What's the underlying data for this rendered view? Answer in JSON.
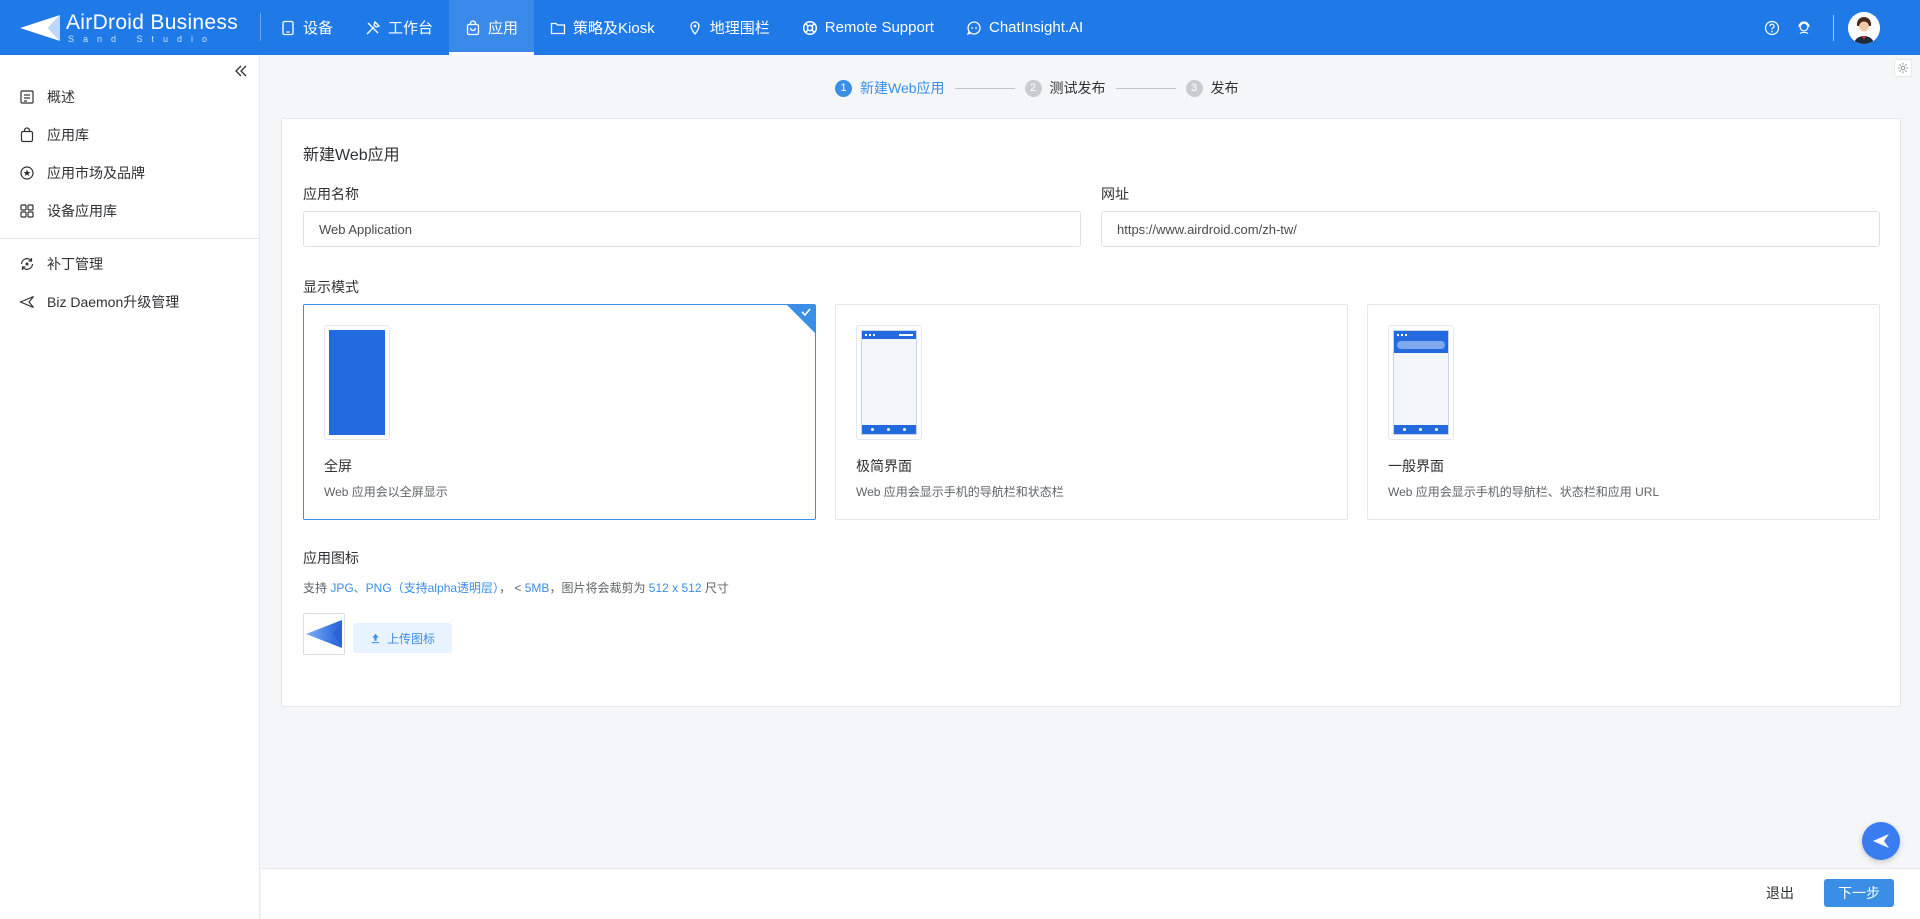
{
  "brand": {
    "title": "AirDroid Business",
    "subtitle": "Sand Studio"
  },
  "nav": {
    "items": [
      {
        "label": "设备",
        "icon": "tablet-icon",
        "active": false
      },
      {
        "label": "工作台",
        "icon": "tools-icon",
        "active": false
      },
      {
        "label": "应用",
        "icon": "app-bag-icon",
        "active": true
      },
      {
        "label": "策略及Kiosk",
        "icon": "folder-icon",
        "active": false
      },
      {
        "label": "地理围栏",
        "icon": "map-pin-icon",
        "active": false
      },
      {
        "label": "Remote Support",
        "icon": "lifebuoy-icon",
        "active": false
      },
      {
        "label": "ChatInsight.AI",
        "icon": "chat-bot-icon",
        "active": false
      }
    ],
    "right_icons": [
      "help-icon",
      "support-agent-icon",
      "user-avatar"
    ]
  },
  "sidebar": {
    "collapse_icon": "double-chevron-left-icon",
    "items": [
      {
        "label": "概述",
        "icon": "overview-icon"
      },
      {
        "label": "应用库",
        "icon": "app-library-icon"
      },
      {
        "label": "应用市场及品牌",
        "icon": "store-brand-icon"
      },
      {
        "label": "设备应用库",
        "icon": "device-apps-icon"
      }
    ],
    "items2": [
      {
        "label": "补丁管理",
        "icon": "patch-icon"
      },
      {
        "label": "Biz Daemon升级管理",
        "icon": "daemon-icon"
      }
    ]
  },
  "steps": [
    {
      "num": "1",
      "label": "新建Web应用",
      "active": true
    },
    {
      "num": "2",
      "label": "测试发布",
      "active": false
    },
    {
      "num": "3",
      "label": "发布",
      "active": false
    }
  ],
  "form": {
    "title": "新建Web应用",
    "name_label": "应用名称",
    "name_value": "Web Application",
    "url_label": "网址",
    "url_value": "https://www.airdroid.com/zh-tw/",
    "mode_label": "显示模式",
    "modes": [
      {
        "title": "全屏",
        "desc": "Web 应用会以全屏显示",
        "selected": true
      },
      {
        "title": "极简界面",
        "desc": "Web 应用会显示手机的导航栏和状态栏",
        "selected": false
      },
      {
        "title": "一般界面",
        "desc": "Web 应用会显示手机的导航栏、状态栏和应用 URL",
        "selected": false
      }
    ],
    "icon_label": "应用图标",
    "icon_hint": {
      "p1": "支持 ",
      "formats": "JPG、PNG（支持alpha透明层）",
      "p2": "， < ",
      "size": "5MB",
      "p3": "，图片将会裁剪为 ",
      "dims": "512 x 512",
      "p4": " 尺寸"
    },
    "upload_label": "上传图标"
  },
  "footer": {
    "exit_label": "退出",
    "next_label": "下一步"
  },
  "colors": {
    "topbar": "#1f7ae8",
    "accent": "#3a8ee6",
    "fab": "#3a7df0"
  }
}
